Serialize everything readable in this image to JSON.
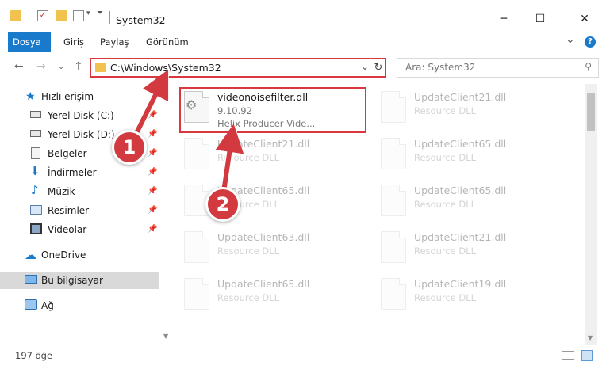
{
  "window": {
    "title": "System32",
    "minimize": "─",
    "maximize": "☐",
    "close": "✕"
  },
  "ribbon": {
    "tabs": [
      "Dosya",
      "Giriş",
      "Paylaş",
      "Görünüm"
    ],
    "active_tab": "Dosya",
    "expand": "⌄",
    "help": "?"
  },
  "address": {
    "path": "C:\\Windows\\System32",
    "search_placeholder": "Ara: System32"
  },
  "sidebar": {
    "quick_access": "Hızlı erişim",
    "items": [
      {
        "label": "Yerel Disk (C:)",
        "icon": "drive-icon"
      },
      {
        "label": "Yerel Disk (D:)",
        "icon": "drive-icon"
      },
      {
        "label": "Belgeler",
        "icon": "documents-icon"
      },
      {
        "label": "İndirmeler",
        "icon": "download-icon"
      },
      {
        "label": "Müzik",
        "icon": "music-icon"
      },
      {
        "label": "Resimler",
        "icon": "pictures-icon"
      },
      {
        "label": "Videolar",
        "icon": "video-icon"
      }
    ],
    "onedrive": "OneDrive",
    "this_pc": "Bu bilgisayar",
    "network": "Ağ"
  },
  "files": {
    "selected": {
      "name": "videonoisefilter.dll",
      "version": "9.10.92",
      "description": "Helix Producer Vide..."
    },
    "background": [
      {
        "name": "UpdateClient21.dll",
        "type": "Resource DLL"
      },
      {
        "name": "UpdateClient21.dll",
        "type": "Resource DLL"
      },
      {
        "name": "UpdateClient65.dll",
        "type": "Resource DLL"
      },
      {
        "name": "UpdateClient65.dll",
        "type": "Resource DLL"
      },
      {
        "name": "UpdateClient65.dll",
        "type": "Resource DLL"
      },
      {
        "name": "UpdateClient63.dll",
        "type": "Resource DLL"
      },
      {
        "name": "UpdateClient21.dll",
        "type": "Resource DLL"
      },
      {
        "name": "UpdateClient65.dll",
        "type": "Resource DLL"
      },
      {
        "name": "UpdateClient19.dll",
        "type": "Resource DLL"
      }
    ]
  },
  "status": {
    "count": "197 öğe"
  },
  "annotations": {
    "step1": "1",
    "step2": "2"
  },
  "colors": {
    "accent": "#1979ca",
    "annotation": "#d9383e"
  }
}
